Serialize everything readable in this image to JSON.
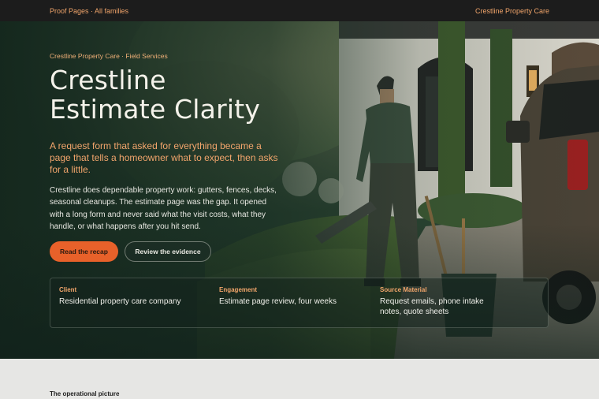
{
  "topbar": {
    "left_link": "Proof Pages · All families",
    "right_link": "Crestline Property Care"
  },
  "hero": {
    "eyebrow": "Crestline Property Care · Field Services",
    "title_line1": "Crestline",
    "title_line2": "Estimate Clarity",
    "lede": "A request form that asked for everything became a page that tells a homeowner what to expect, then asks for a little.",
    "body": "Crestline does dependable property work: gutters, fences, decks, seasonal cleanups. The estimate page was the gap. It opened with a long form and never said what the visit costs, what they handle, or what happens after you hit send.",
    "primary_button": "Read the recap",
    "secondary_button": "Review the evidence"
  },
  "facts": [
    {
      "label": "Client",
      "value": "Residential property care company"
    },
    {
      "label": "Engagement",
      "value": "Estimate page review, four weeks"
    },
    {
      "label": "Source Material",
      "value": "Request emails, phone intake notes, quote sheets"
    }
  ],
  "lower": {
    "section_title": "The operational picture"
  },
  "colors": {
    "accent": "#e8612a",
    "accent_text": "#f0a46a",
    "topbar": "#1c1c1c",
    "hero_dark": "#1d3226"
  }
}
